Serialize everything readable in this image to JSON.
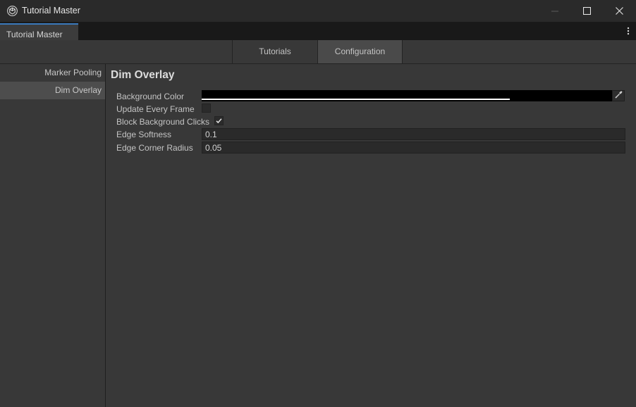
{
  "window": {
    "title": "Tutorial Master",
    "icon": "unity-cube-icon",
    "controls": [
      "minimize-icon",
      "maximize-icon",
      "close-icon"
    ]
  },
  "doc_tab": {
    "label": "Tutorial Master"
  },
  "tabs": [
    {
      "label": "Tutorials",
      "active": false
    },
    {
      "label": "Configuration",
      "active": true
    }
  ],
  "sidebar": {
    "items": [
      {
        "label": "Marker Pooling",
        "selected": false
      },
      {
        "label": "Dim Overlay",
        "selected": true
      }
    ]
  },
  "section": {
    "title": "Dim Overlay",
    "fields": {
      "background_color": {
        "label": "Background Color",
        "value": "#000000",
        "alpha_fraction": 0.75
      },
      "update_every_frame": {
        "label": "Update Every Frame",
        "checked": false
      },
      "block_background_clicks": {
        "label": "Block Background Clicks",
        "checked": true
      },
      "edge_softness": {
        "label": "Edge Softness",
        "value": "0.1"
      },
      "edge_corner_radius": {
        "label": "Edge Corner Radius",
        "value": "0.05"
      }
    }
  },
  "colors": {
    "accent": "#3a79bb",
    "background": "#383838",
    "field": "#2a2a2a"
  }
}
